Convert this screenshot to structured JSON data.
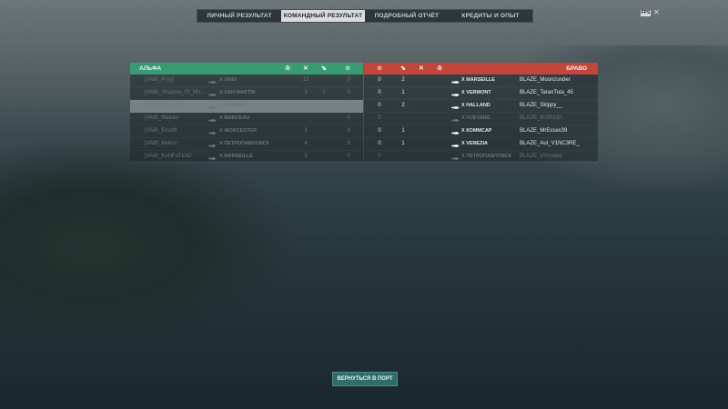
{
  "tabs": [
    {
      "label": "ЛИЧНЫЙ РЕЗУЛЬТАТ",
      "active": false
    },
    {
      "label": "КОМАНДНЫЙ РЕЗУЛЬТАТ",
      "active": true
    },
    {
      "label": "ПОДРОБНЫЙ ОТЧЁТ",
      "active": false
    },
    {
      "label": "КРЕДИТЫ И ОПЫТ",
      "active": false
    }
  ],
  "window": {
    "badge_text": "FPS",
    "close_glyph": "✕"
  },
  "alpha": {
    "name": "АЛЬФА",
    "color": "#3a9a73",
    "players": [
      {
        "player": "[VABI_Pryy]",
        "ship": "X OHIO",
        "c1": "15",
        "c2": "",
        "c3": "",
        "c4": "0",
        "state": "dead"
      },
      {
        "player": "[VABI_Shadow_Of_Mo…",
        "ship": "X SAN MARTÍN",
        "c1": "3",
        "c2": "2",
        "c3": "",
        "c4": "0",
        "state": "dead"
      },
      {
        "player": "[VABI_frew_tray",
        "ship": "X SOMERS",
        "c1": "",
        "c2": "",
        "c3": "",
        "c4": "0",
        "state": "selected"
      },
      {
        "player": "[VABI_Makavr",
        "ship": "X MARCEAU",
        "c1": "",
        "c2": "",
        "c3": "",
        "c4": "0",
        "state": "dead"
      },
      {
        "player": "[VABI_Enooff",
        "ship": "X WORCESTER",
        "c1": "3",
        "c2": "",
        "c3": "",
        "c4": "0",
        "state": "dead"
      },
      {
        "player": "[VABI_Belkor",
        "ship": "X ПЕТРОПАВЛОВСК",
        "c1": "4",
        "c2": "",
        "c3": "",
        "c4": "0",
        "state": "dead"
      },
      {
        "player": "[VABI_KoHFeTkoO",
        "ship": "X MARSEILLE",
        "c1": "3",
        "c2": "",
        "c3": "",
        "c4": "0",
        "state": "dead"
      }
    ]
  },
  "bravo": {
    "name": "БРАВО",
    "color": "#c2463a",
    "players": [
      {
        "player": "BLAZE_Moonzunder",
        "ship": "X MARSEILLE",
        "c1": "0",
        "c2": "2",
        "state": "alive"
      },
      {
        "player": "BLAZE_TaranTula_45",
        "ship": "X VERMONT",
        "c1": "0",
        "c2": "1",
        "state": "alive"
      },
      {
        "player": "BLAZE_Skippy__",
        "ship": "X HALLAND",
        "c1": "0",
        "c2": "2",
        "state": "alive"
      },
      {
        "player": "BLAZE_IKARASI",
        "ship": "X YUEYANG",
        "c1": "0",
        "c2": "",
        "state": "dead"
      },
      {
        "player": "BLAZE_MrEssex39",
        "ship": "X КОММСАР",
        "c1": "0",
        "c2": "1",
        "state": "alive"
      },
      {
        "player": "BLAZE_Aut_V1NC3RE_",
        "ship": "X VENEZIA",
        "c1": "0",
        "c2": "1",
        "state": "alive"
      },
      {
        "player": "BLAZE_UVsnake",
        "ship": "X ПЕТРОПАВЛОВСК",
        "c1": "0",
        "c2": "",
        "state": "dead"
      }
    ]
  },
  "column_icons": {
    "xp": "♔",
    "kills": "✕",
    "planes": "⬊",
    "capture": "☆"
  },
  "footer": {
    "return_label": "ВЕРНУТЬСЯ В ПОРТ"
  }
}
